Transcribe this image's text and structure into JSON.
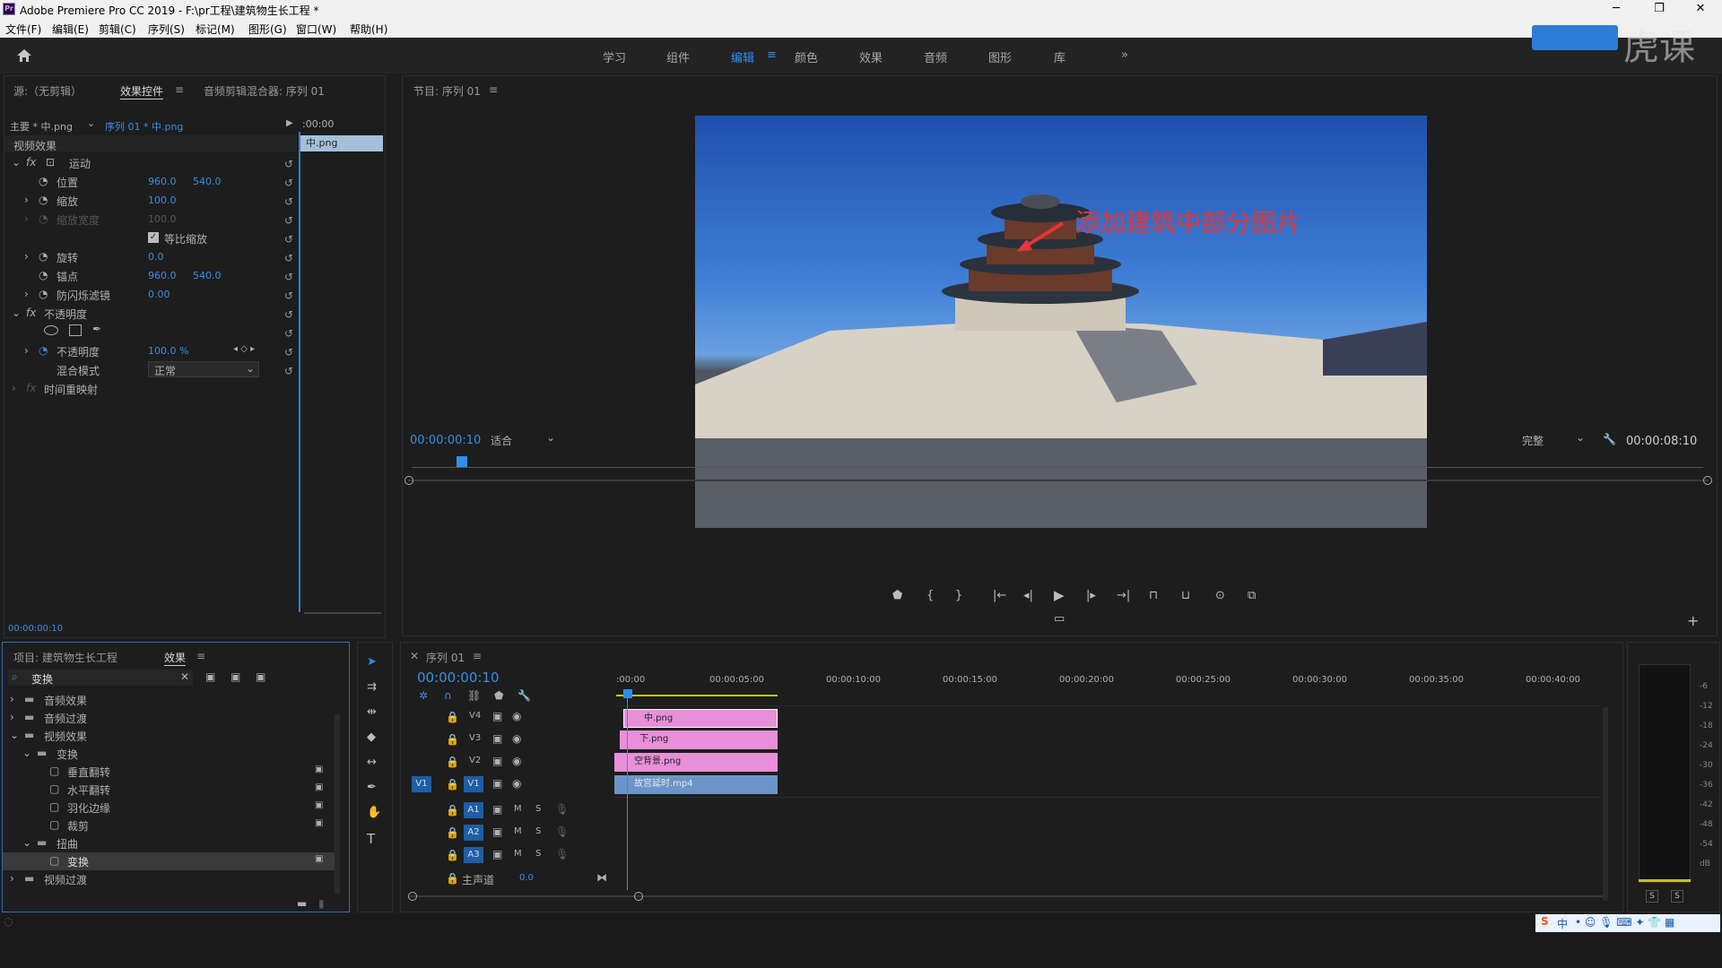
{
  "titlebar": {
    "logo": "Pr",
    "title": "Adobe Premiere Pro CC 2019 - F:\\pr工程\\建筑物生长工程 *",
    "minimize": "─",
    "maximize": "❐",
    "close": "✕"
  },
  "menu": [
    "文件(F)",
    "编辑(E)",
    "剪辑(C)",
    "序列(S)",
    "标记(M)",
    "图形(G)",
    "窗口(W)",
    "帮助(H)"
  ],
  "workspaces": {
    "tabs": [
      "学习",
      "组件",
      "编辑",
      "颜色",
      "效果",
      "音频",
      "图形",
      "库"
    ],
    "active": "编辑",
    "more": "»",
    "menu_icon": "≡"
  },
  "watermark": "虎课网",
  "effect_controls": {
    "tabs": [
      "源:（无剪辑）",
      "效果控件",
      "音频剪辑混合器: 序列 01"
    ],
    "active_tab": "效果控件",
    "master": "主要 * 中.png",
    "sequence": "序列 01 * 中.png",
    "timecode_start": ":00:00",
    "clip_label": "中.png",
    "section": "视频效果",
    "motion": "运动",
    "props": [
      {
        "name": "位置",
        "v1": "960.0",
        "v2": "540.0"
      },
      {
        "name": "缩放",
        "v1": "100.0",
        "v2": ""
      },
      {
        "name": "缩放宽度",
        "v1": "100.0",
        "v2": ""
      },
      {
        "name": "等比缩放",
        "v1": "",
        "v2": ""
      },
      {
        "name": "旋转",
        "v1": "0.0",
        "v2": ""
      },
      {
        "name": "锚点",
        "v1": "960.0",
        "v2": "540.0"
      },
      {
        "name": "防闪烁滤镜",
        "v1": "0.00",
        "v2": ""
      }
    ],
    "opacity_group": "不透明度",
    "opacity_name": "不透明度",
    "opacity_val": "100.0 %",
    "blend_name": "混合模式",
    "blend_val": "正常",
    "time_remap": "时间重映射",
    "footer_timecode": "00:00:00:10"
  },
  "program": {
    "title": "节目: 序列 01",
    "timecode": "00:00:00:10",
    "fit": "适合",
    "quality": "完整",
    "duration": "00:00:08:10",
    "annotation": "添加建筑中部分图片"
  },
  "project": {
    "tabs": [
      "项目: 建筑物生长工程",
      "效果"
    ],
    "active_tab": "效果",
    "search": "变换",
    "tree": [
      {
        "label": "音频效果",
        "level": 0,
        "open": false
      },
      {
        "label": "音频过渡",
        "level": 0,
        "open": false
      },
      {
        "label": "视频效果",
        "level": 0,
        "open": true
      },
      {
        "label": "变换",
        "level": 1,
        "open": true
      },
      {
        "label": "垂直翻转",
        "level": 2,
        "leaf": true
      },
      {
        "label": "水平翻转",
        "level": 2,
        "leaf": true
      },
      {
        "label": "羽化边缘",
        "level": 2,
        "leaf": true
      },
      {
        "label": "裁剪",
        "level": 2,
        "leaf": true
      },
      {
        "label": "扭曲",
        "level": 1,
        "open": true
      },
      {
        "label": "变换",
        "level": 2,
        "leaf": true,
        "selected": true
      },
      {
        "label": "视频过渡",
        "level": 0,
        "open": false
      }
    ]
  },
  "timeline": {
    "title": "序列 01",
    "timecode": "00:00:00:10",
    "ruler": [
      ":00:00",
      "00:00:05:00",
      "00:00:10:00",
      "00:00:15:00",
      "00:00:20:00",
      "00:00:25:00",
      "00:00:30:00",
      "00:00:35:00",
      "00:00:40:00"
    ],
    "video_tracks": [
      "V4",
      "V3",
      "V2",
      "V1"
    ],
    "audio_tracks": [
      "A1",
      "A2",
      "A3"
    ],
    "source_patch": "V1",
    "master": "主声道",
    "master_val": "0.0",
    "clips": [
      {
        "name": "中.png",
        "track": "V4",
        "color": "#e88fd9"
      },
      {
        "name": "下.png",
        "track": "V3",
        "color": "#e88fd9"
      },
      {
        "name": "空背景.png",
        "track": "V2",
        "color": "#e88fd9"
      },
      {
        "name": "故宫延时.mp4",
        "track": "V1",
        "color": "#6b94c8"
      }
    ],
    "m": "M",
    "s": "S"
  },
  "meter": {
    "scale": [
      "-6",
      "-12",
      "-18",
      "-24",
      "-30",
      "-36",
      "-42",
      "-48",
      "-54",
      "dB"
    ],
    "solo": "S"
  },
  "taskbar": {
    "ime": "中"
  }
}
